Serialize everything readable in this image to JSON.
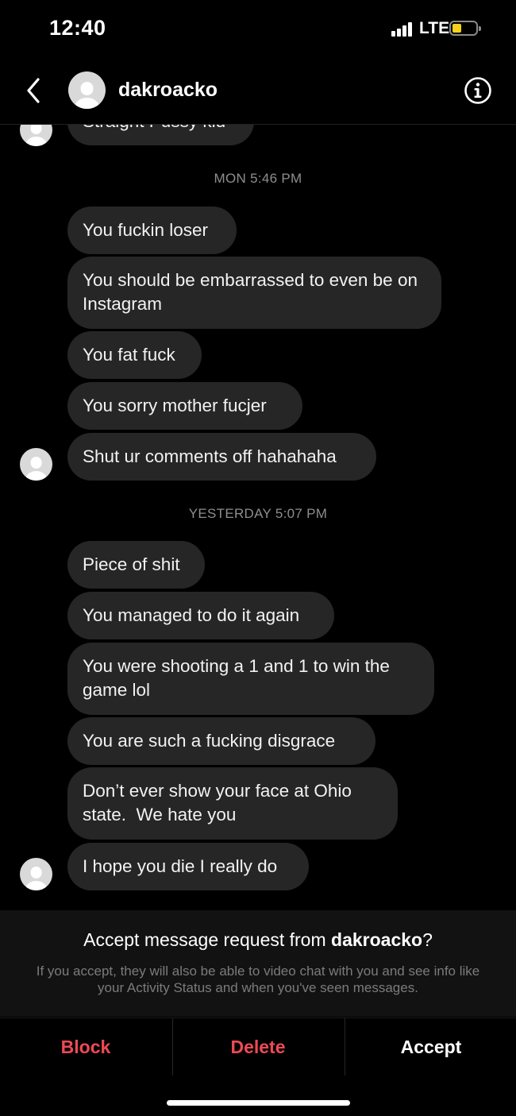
{
  "status_bar": {
    "time": "12:40",
    "network": "LTE",
    "battery_level": 0.3,
    "battery_color": "#f6d31a"
  },
  "header": {
    "username": "dakroacko",
    "back_icon": "chevron-left-icon",
    "info_icon": "info-circle-icon"
  },
  "conversation": {
    "partial_message": "Straight Pussy kid",
    "groups": [
      {
        "timestamp": "MON 5:46 PM",
        "messages": [
          "You fuckin loser",
          "You should be embarrassed to even be on Instagram",
          "You fat fuck",
          "You sorry mother fucjer",
          "Shut ur comments off hahahaha"
        ]
      },
      {
        "timestamp": "YESTERDAY 5:07 PM",
        "messages": [
          "Piece of shit",
          "You managed to do it again",
          "You were shooting a 1 and 1 to win the game lol",
          "You are such a fucking disgrace",
          "Don’t ever show your face at Ohio state.  We hate you",
          "I hope you die I really do"
        ]
      }
    ]
  },
  "request": {
    "title_prefix": "Accept message request from ",
    "title_username": "dakroacko",
    "title_suffix": "?",
    "description": "If you accept, they will also be able to video chat with you and see info like your Activity Status and when you've seen messages."
  },
  "actions": {
    "block": "Block",
    "delete": "Delete",
    "accept": "Accept",
    "danger_color": "#ed4956"
  }
}
